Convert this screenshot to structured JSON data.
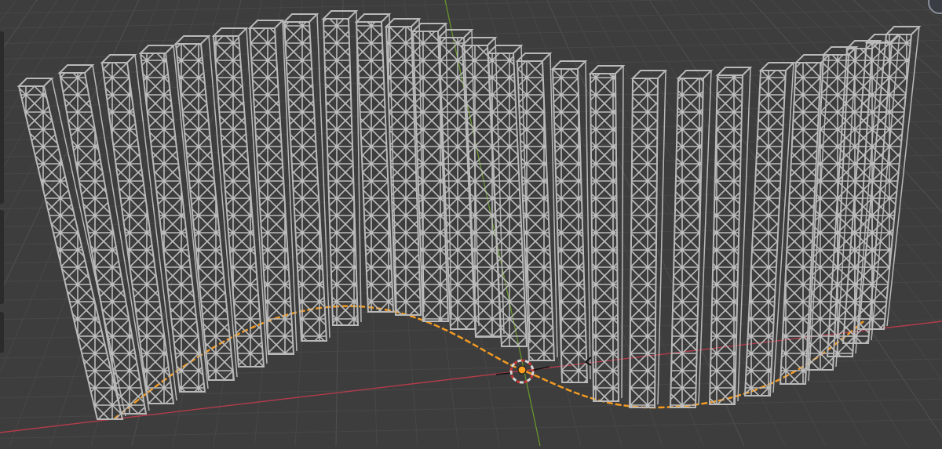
{
  "app": {
    "title": "",
    "mode": "3D Viewport"
  },
  "icons": {
    "origin_marker": "origin-dot-icon",
    "cursor_3d": "3d-cursor-icon",
    "corner_gizmo": "navigation-gizmo-icon",
    "empty_handle": "empty-axes-icon"
  },
  "colors": {
    "background": "#3d3d3d",
    "grid_minor": "#474747",
    "grid_major": "#505050",
    "x_axis": "#b23c4a",
    "y_axis": "#6a9a2a",
    "curve": "#f09a22",
    "lattice": "#b9b9b9",
    "origin": "#ff9e1e"
  },
  "scene": {
    "object_type": "lattice columns along curve",
    "column_count": 24,
    "selected_object": "curve"
  }
}
